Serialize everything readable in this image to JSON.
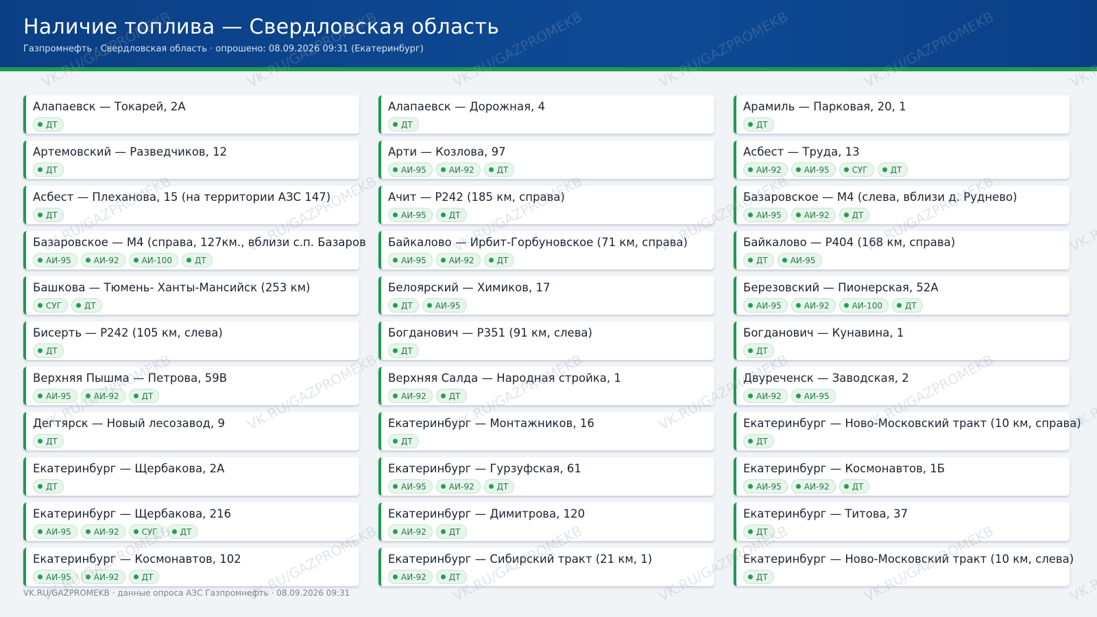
{
  "header": {
    "title": "Наличие топлива — Свердловская область",
    "subtitle": "Газпромнефть · Свердловская область · опрошено: 08.09.2026 09:31 (Екатеринбург)"
  },
  "watermark": "VK.RU/GAZPROMEKB",
  "footer": "VK.RU/GAZPROMEKB · данные опроса АЗС Газпромнефть · 08.09.2026 09:31",
  "stations": [
    {
      "name": "Алапаевск — Токарей, 2А",
      "fuels": [
        "ДТ"
      ]
    },
    {
      "name": "Алапаевск — Дорожная, 4",
      "fuels": [
        "ДТ"
      ]
    },
    {
      "name": "Арамиль — Парковая, 20, 1",
      "fuels": [
        "ДТ"
      ]
    },
    {
      "name": "Артемовский — Разведчиков, 12",
      "fuels": [
        "ДТ"
      ]
    },
    {
      "name": "Арти — Козлова, 97",
      "fuels": [
        "АИ-95",
        "АИ-92",
        "ДТ"
      ]
    },
    {
      "name": "Асбест — Труда, 13",
      "fuels": [
        "АИ-92",
        "АИ-95",
        "СУГ",
        "ДТ"
      ]
    },
    {
      "name": "Асбест — Плеханова, 15 (на территории АЗС 147)",
      "fuels": [
        "ДТ"
      ]
    },
    {
      "name": "Ачит — Р242 (185 км, справа)",
      "fuels": [
        "АИ-95",
        "ДТ"
      ]
    },
    {
      "name": "Базаровское — М4 (слева, вблизи д. Руднево)",
      "fuels": [
        "АИ-95",
        "АИ-92",
        "ДТ"
      ]
    },
    {
      "name": "Базаровское — М4 (справа, 127км., вблизи с.п. Базаров",
      "fuels": [
        "АИ-95",
        "АИ-92",
        "АИ-100",
        "ДТ"
      ]
    },
    {
      "name": "Байкалово — Ирбит-Горбуновское (71 км, справа)",
      "fuels": [
        "АИ-95",
        "АИ-92",
        "ДТ"
      ]
    },
    {
      "name": "Байкалово — Р404 (168 км, справа)",
      "fuels": [
        "ДТ",
        "АИ-95"
      ]
    },
    {
      "name": "Башкова — Тюмень- Ханты-Мансийск (253 км)",
      "fuels": [
        "СУГ",
        "ДТ"
      ]
    },
    {
      "name": "Белоярский — Химиков, 17",
      "fuels": [
        "ДТ",
        "АИ-95"
      ]
    },
    {
      "name": "Березовский — Пионерская, 52А",
      "fuels": [
        "АИ-95",
        "АИ-92",
        "АИ-100",
        "ДТ"
      ]
    },
    {
      "name": "Бисерть — Р242 (105 км, слева)",
      "fuels": [
        "ДТ"
      ]
    },
    {
      "name": "Богданович — Р351 (91 км, слева)",
      "fuels": [
        "ДТ"
      ]
    },
    {
      "name": "Богданович — Кунавина, 1",
      "fuels": [
        "ДТ"
      ]
    },
    {
      "name": "Верхняя Пышма — Петрова, 59В",
      "fuels": [
        "АИ-95",
        "АИ-92",
        "ДТ"
      ]
    },
    {
      "name": "Верхняя Салда — Народная стройка, 1",
      "fuels": [
        "АИ-92",
        "ДТ"
      ]
    },
    {
      "name": "Двуреченск — Заводская, 2",
      "fuels": [
        "АИ-92",
        "АИ-95"
      ]
    },
    {
      "name": "Дегтярск — Новый лесозавод, 9",
      "fuels": [
        "ДТ"
      ]
    },
    {
      "name": "Екатеринбург — Монтажников, 16",
      "fuels": [
        "ДТ"
      ]
    },
    {
      "name": "Екатеринбург — Ново-Московский тракт (10 км, справа)",
      "fuels": [
        "ДТ"
      ]
    },
    {
      "name": "Екатеринбург — Щербакова, 2А",
      "fuels": [
        "ДТ"
      ]
    },
    {
      "name": "Екатеринбург — Гурзуфская, 61",
      "fuels": [
        "АИ-95",
        "АИ-92",
        "ДТ"
      ]
    },
    {
      "name": "Екатеринбург — Космонавтов, 1Б",
      "fuels": [
        "АИ-95",
        "АИ-92",
        "ДТ"
      ]
    },
    {
      "name": "Екатеринбург — Щербакова, 216",
      "fuels": [
        "АИ-95",
        "АИ-92",
        "СУГ",
        "ДТ"
      ]
    },
    {
      "name": "Екатеринбург — Димитрова, 120",
      "fuels": [
        "АИ-92",
        "ДТ"
      ]
    },
    {
      "name": "Екатеринбург — Титова, 37",
      "fuels": [
        "ДТ"
      ]
    },
    {
      "name": "Екатеринбург — Космонавтов, 102",
      "fuels": [
        "АИ-95",
        "АИ-92",
        "ДТ"
      ]
    },
    {
      "name": "Екатеринбург — Сибирский тракт (21 км, 1)",
      "fuels": [
        "АИ-92",
        "ДТ"
      ]
    },
    {
      "name": "Екатеринбург — Ново-Московский тракт (10 км, слева)",
      "fuels": [
        "ДТ"
      ]
    }
  ]
}
